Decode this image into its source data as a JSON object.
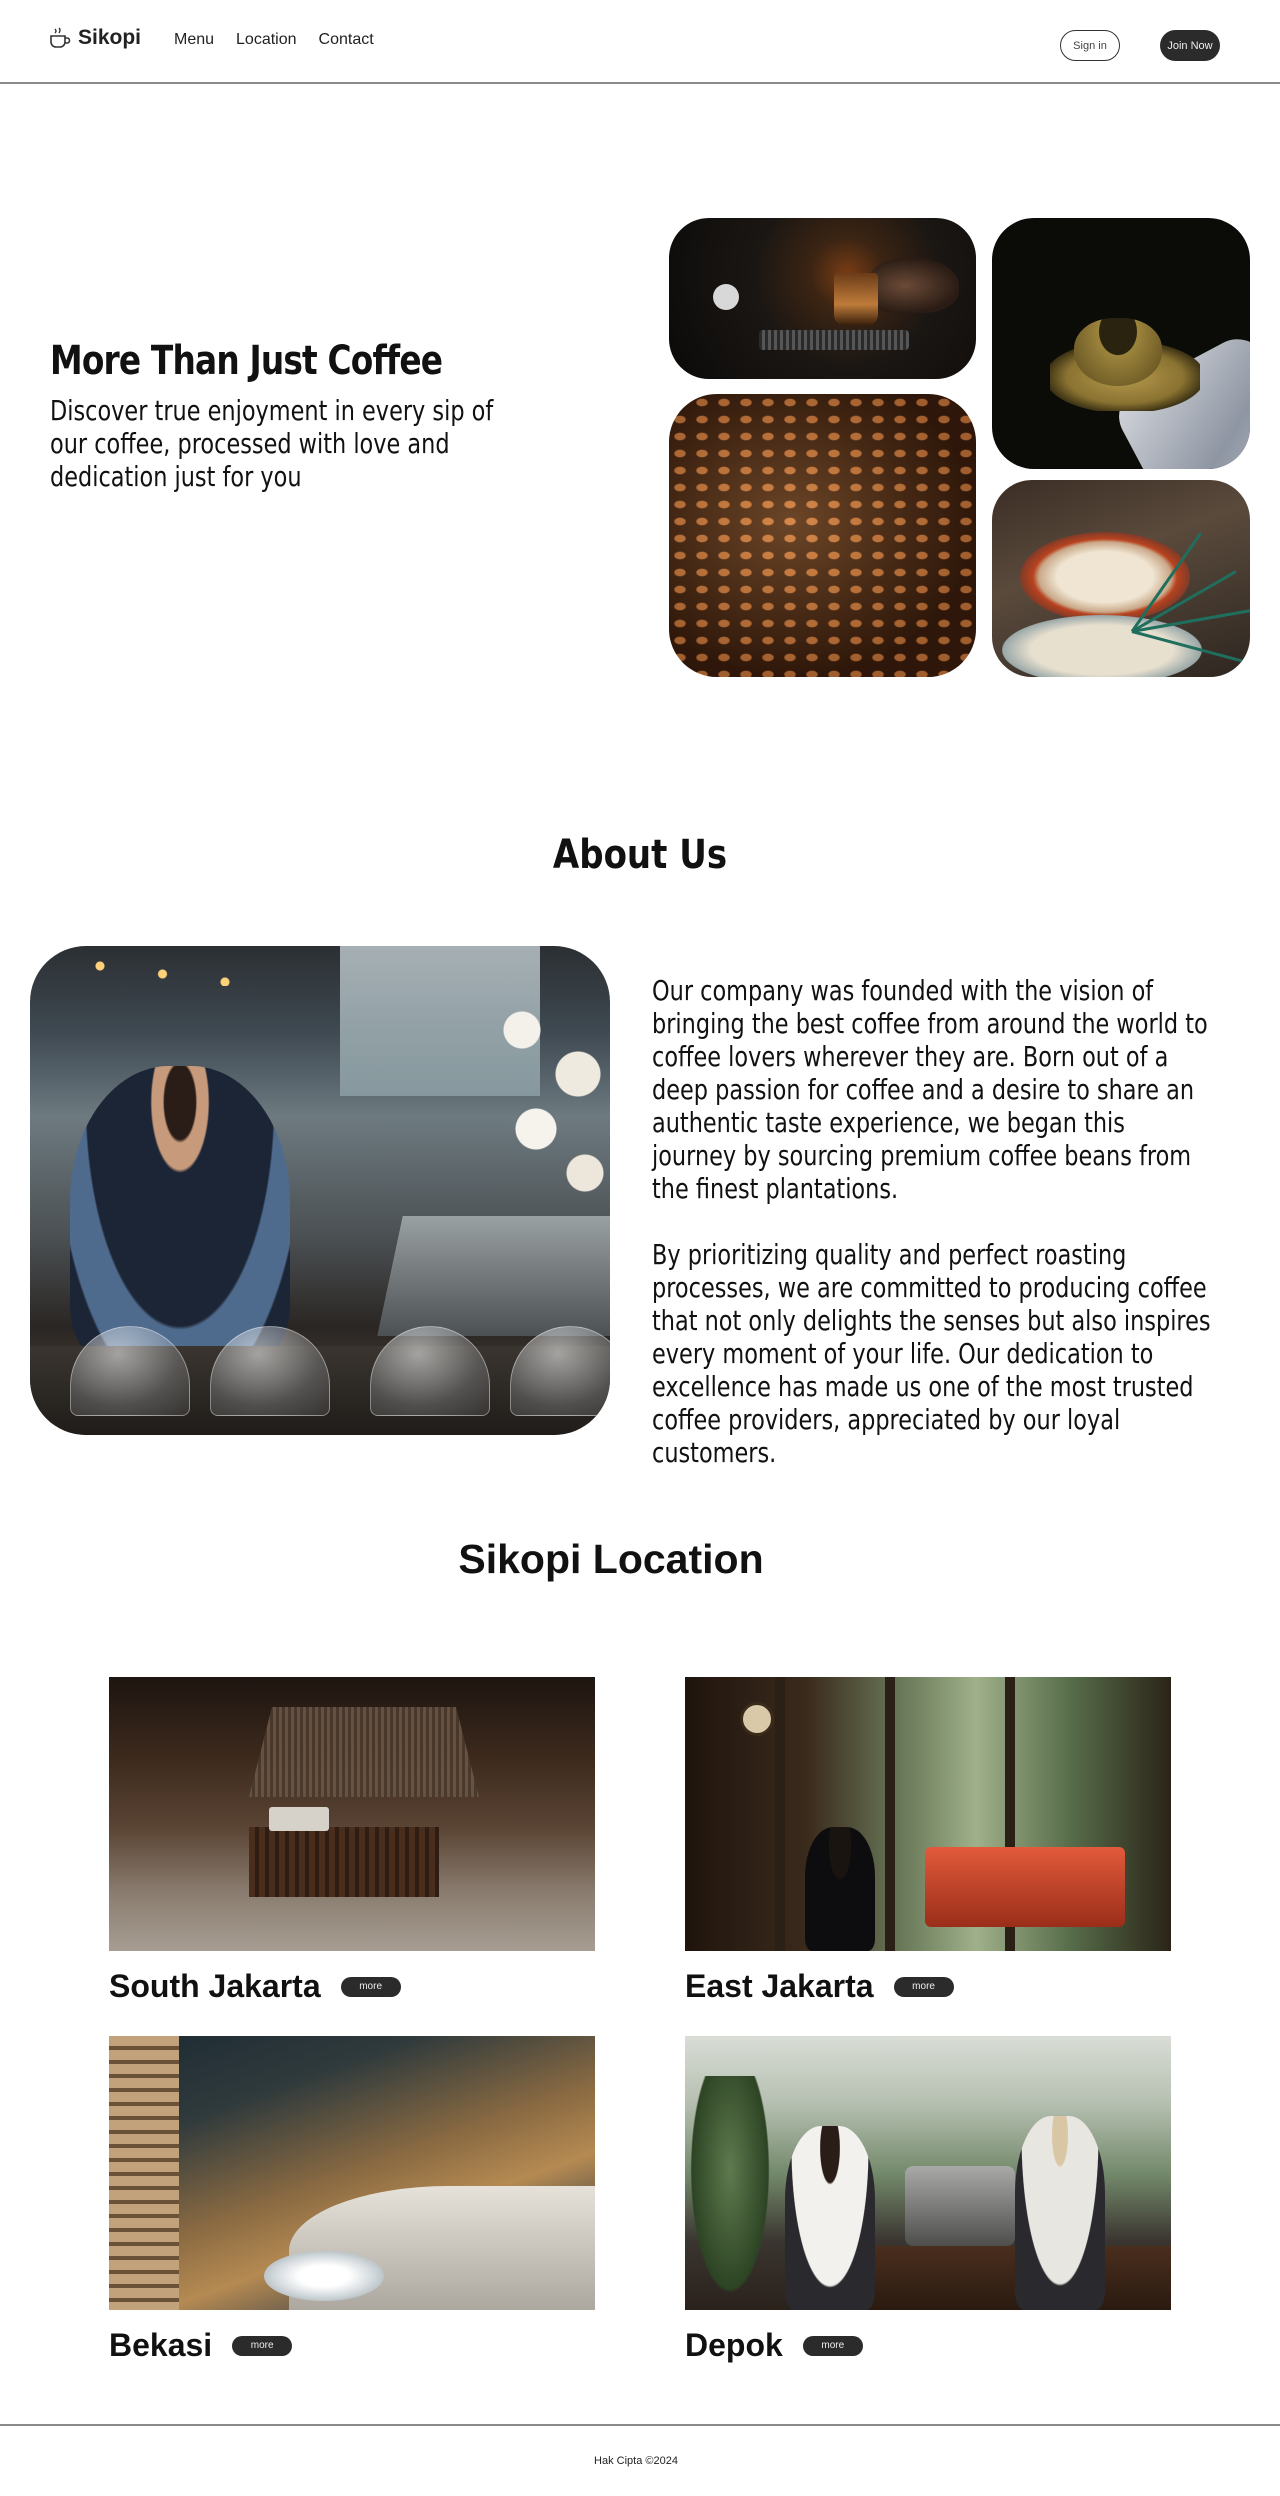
{
  "nav": {
    "logo": "Sikopi",
    "links": [
      "Menu",
      "Location",
      "Contact"
    ],
    "sign_in": "Sign in",
    "join": "Join Now"
  },
  "hero": {
    "title": "More Than Just Coffee",
    "subtitle": "Discover true enjoyment in every sip of our coffee, processed with love and dedication just for you"
  },
  "about": {
    "title": "About Us",
    "paragraphs": [
      "Our company was founded with the vision of bringing the best coffee from around the world to coffee lovers wherever they are. Born out of a deep passion for coffee and a desire to share an authentic taste experience, we began this journey by sourcing premium coffee beans from the finest plantations.",
      "By prioritizing quality and perfect roasting processes, we are committed to producing coffee that not only delights the senses but also inspires every moment of your life. Our dedication to excellence has made us one of the most trusted coffee providers, appreciated by our loyal customers."
    ]
  },
  "locations": {
    "title": "Sikopi Location",
    "more_label": "more",
    "items": [
      {
        "name": "South Jakarta"
      },
      {
        "name": "East Jakarta"
      },
      {
        "name": "Bekasi"
      },
      {
        "name": "Depok"
      }
    ]
  },
  "footer": {
    "copyright": "Hak Cipta ©2024"
  }
}
